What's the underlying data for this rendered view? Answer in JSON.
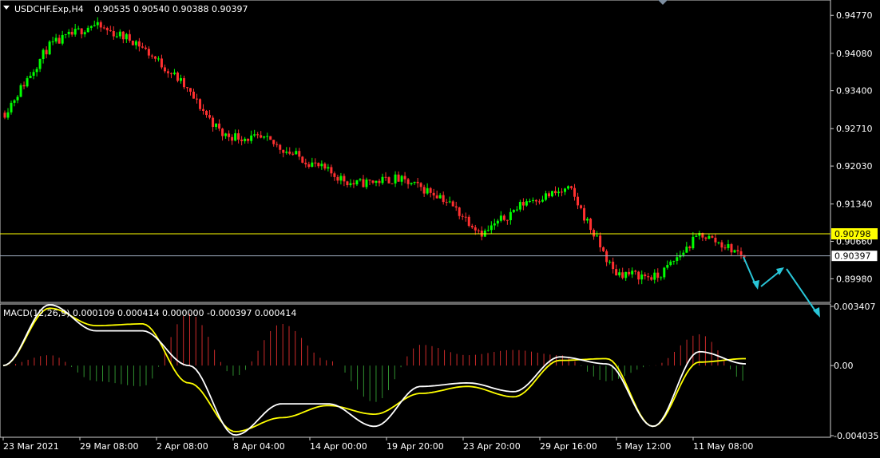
{
  "chart_data": [
    {
      "type": "candlestick",
      "header": {
        "symbol": "USDCHF.Exp,H4",
        "ohlc": "0.90535 0.90540 0.90388 0.90397"
      },
      "y_ticks": [
        "0.94770",
        "0.94080",
        "0.93400",
        "0.92710",
        "0.92030",
        "0.91340",
        "0.90660",
        "0.89980"
      ],
      "ylim": [
        0.8958,
        0.9502
      ],
      "x_ticks": [
        "23 Mar 2021",
        "29 Mar 08:00",
        "2 Apr 08:00",
        "8 Apr 04:00",
        "14 Apr 00:00",
        "19 Apr 20:00",
        "23 Apr 20:00",
        "29 Apr 16:00",
        "5 May 12:00",
        "11 May 08:00"
      ],
      "horizontal_lines": [
        {
          "value": "0.90798",
          "color": "#ffff00"
        },
        {
          "value": "0.90397",
          "color": "#a0aec0"
        }
      ],
      "up_color": "#00ff00",
      "down_color": "#ff3030",
      "projection_color": "#29c6d8",
      "key_points": [
        {
          "time": "23 Mar 2021",
          "price": 0.93
        },
        {
          "time": "26 Mar",
          "price": 0.942
        },
        {
          "time": "30 Mar",
          "price": 0.946
        },
        {
          "time": "1 Apr",
          "price": 0.943
        },
        {
          "time": "2 Apr 08:00",
          "price": 0.936
        },
        {
          "time": "6 Apr",
          "price": 0.926
        },
        {
          "time": "9 Apr",
          "price": 0.925
        },
        {
          "time": "13 Apr",
          "price": 0.921
        },
        {
          "time": "16 Apr",
          "price": 0.917
        },
        {
          "time": "20 Apr",
          "price": 0.918
        },
        {
          "time": "23 Apr 20:00",
          "price": 0.915
        },
        {
          "time": "28 Apr",
          "price": 0.908
        },
        {
          "time": "1 May",
          "price": 0.914
        },
        {
          "time": "4 May",
          "price": 0.916
        },
        {
          "time": "6 May",
          "price": 0.901
        },
        {
          "time": "10 May",
          "price": 0.9
        },
        {
          "time": "11 May 08:00",
          "price": 0.908
        },
        {
          "time": "12 May",
          "price": 0.904
        }
      ]
    },
    {
      "type": "line",
      "header": "MACD(12,26,9) 0.000109 0.000414 0.000000 -0.000397 0.000414",
      "y_ticks": [
        "0.003407",
        "0.00",
        "-0.004035"
      ],
      "ylim": [
        -0.004035,
        0.003407
      ],
      "series": [
        {
          "color": "#ffffff",
          "values": [
            0.0,
            0.0035,
            0.002,
            0.002,
            0.0,
            -0.004,
            -0.0022,
            -0.0022,
            -0.0035,
            -0.0012,
            -0.001,
            -0.0015,
            0.0005,
            0.0001,
            -0.0035,
            0.0008,
            0.0001
          ]
        },
        {
          "color": "#ffff00",
          "values": [
            0.0,
            0.0033,
            0.0023,
            0.0024,
            -0.001,
            -0.0038,
            -0.003,
            -0.0023,
            -0.0028,
            -0.0016,
            -0.0012,
            -0.0018,
            0.0003,
            0.0004,
            -0.0035,
            0.0002,
            0.0004
          ]
        }
      ],
      "histogram_up_color": "#cc2a2a",
      "histogram_down_color": "#2f8f2f"
    }
  ]
}
